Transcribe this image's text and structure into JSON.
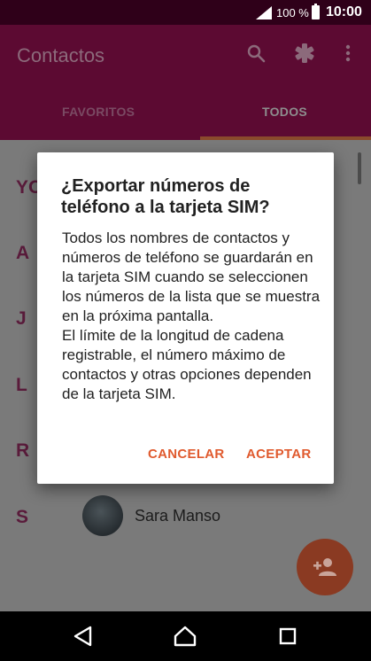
{
  "status_bar": {
    "battery": "100 %",
    "time": "10:00"
  },
  "app_bar": {
    "title": "Contactos",
    "icons": [
      "search-icon",
      "settings-icon",
      "more-vert-icon"
    ],
    "tabs": [
      {
        "label": "FAVORITOS",
        "selected": false
      },
      {
        "label": "TODOS",
        "selected": true
      }
    ]
  },
  "contacts": {
    "section_letters": [
      "YO",
      "A",
      "J",
      "L",
      "R",
      "S"
    ],
    "visible_contact": {
      "name": "Sara Manso"
    }
  },
  "dialog": {
    "title": "¿Exportar números de teléfono a la tarjeta SIM?",
    "body_line1": "Todos los nombres de contactos y números de teléfono se guardarán en la tarjeta SIM cuando se seleccionen los números de la lista que se muestra en la próxima pantalla.",
    "body_line2": "El límite de la longitud de cadena registrable, el número máximo de contactos y otras opciones dependen de la tarjeta SIM.",
    "cancel_label": "CANCELAR",
    "ok_label": "ACEPTAR"
  },
  "fab": {
    "icon": "add-contact-icon"
  },
  "nav_bar": {
    "icons": [
      "back-icon",
      "home-icon",
      "recents-icon"
    ]
  },
  "colors": {
    "primary": "#b8145e",
    "accent": "#e05a2e"
  }
}
